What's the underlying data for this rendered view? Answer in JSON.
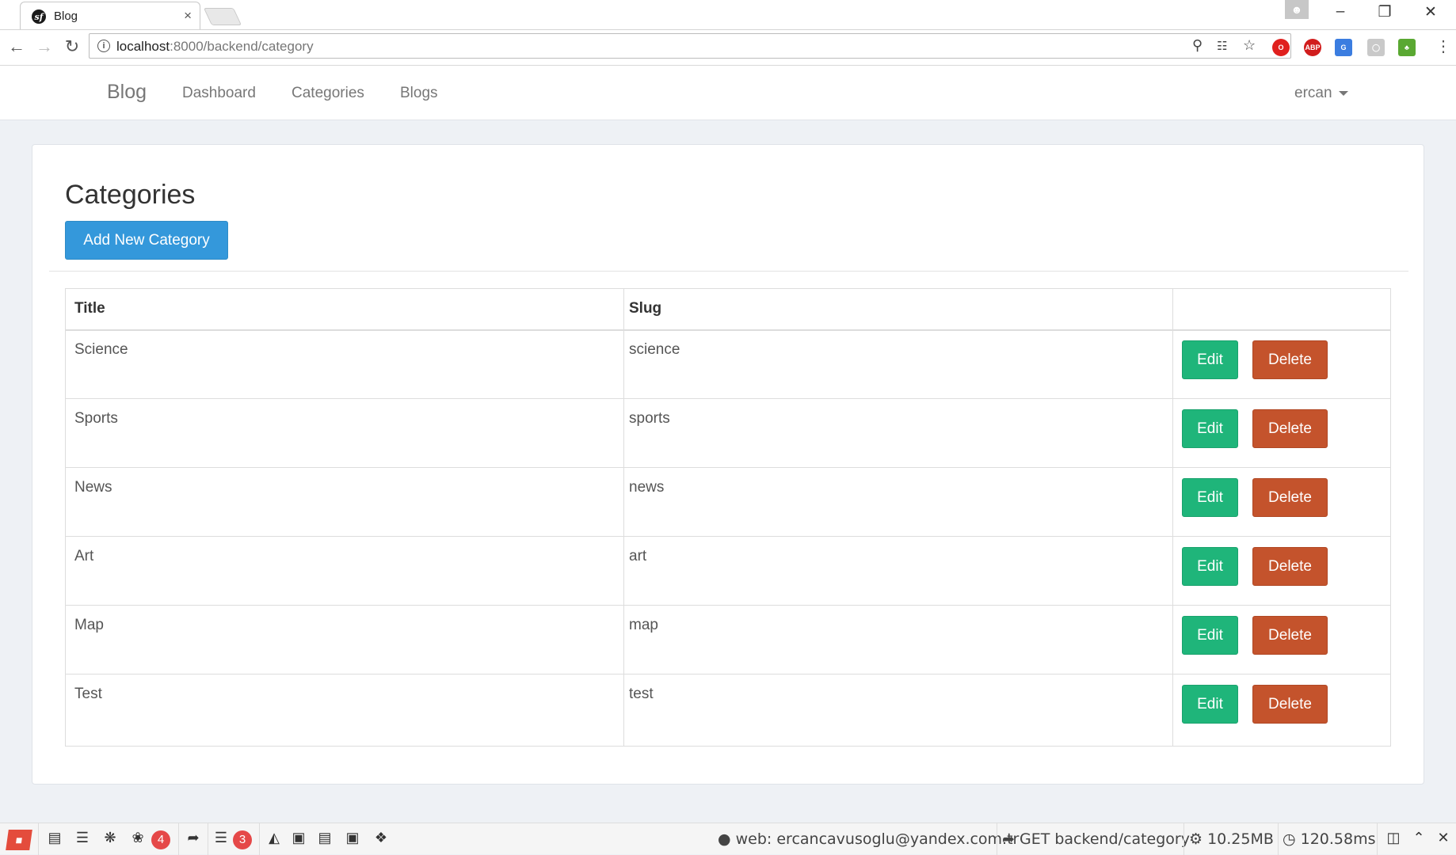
{
  "browser": {
    "tab_title": "Blog",
    "tab_close": "×",
    "url_host": "localhost",
    "url_path": ":8000/backend/category"
  },
  "app": {
    "brand": "Blog",
    "nav": [
      "Dashboard",
      "Categories",
      "Blogs"
    ],
    "user": "ercan"
  },
  "page": {
    "title": "Categories",
    "add_button": "Add New Category"
  },
  "table": {
    "headers": [
      "Title",
      "Slug",
      ""
    ],
    "rows": [
      {
        "title": "Science",
        "slug": "science"
      },
      {
        "title": "Sports",
        "slug": "sports"
      },
      {
        "title": "News",
        "slug": "news"
      },
      {
        "title": "Art",
        "slug": "art"
      },
      {
        "title": "Map",
        "slug": "map"
      },
      {
        "title": "Test",
        "slug": "test"
      }
    ],
    "edit_label": "Edit",
    "delete_label": "Delete"
  },
  "debugbar": {
    "doctrine_count": "4",
    "db_count": "3",
    "user": "web: ercancavusoglu@yandex.com.tr",
    "request": "GET backend/category",
    "memory": "10.25MB",
    "time": "120.58ms"
  },
  "colors": {
    "primary": "#3498db",
    "edit": "#1fb57a",
    "delete": "#c4532c",
    "badge": "#e54848"
  }
}
